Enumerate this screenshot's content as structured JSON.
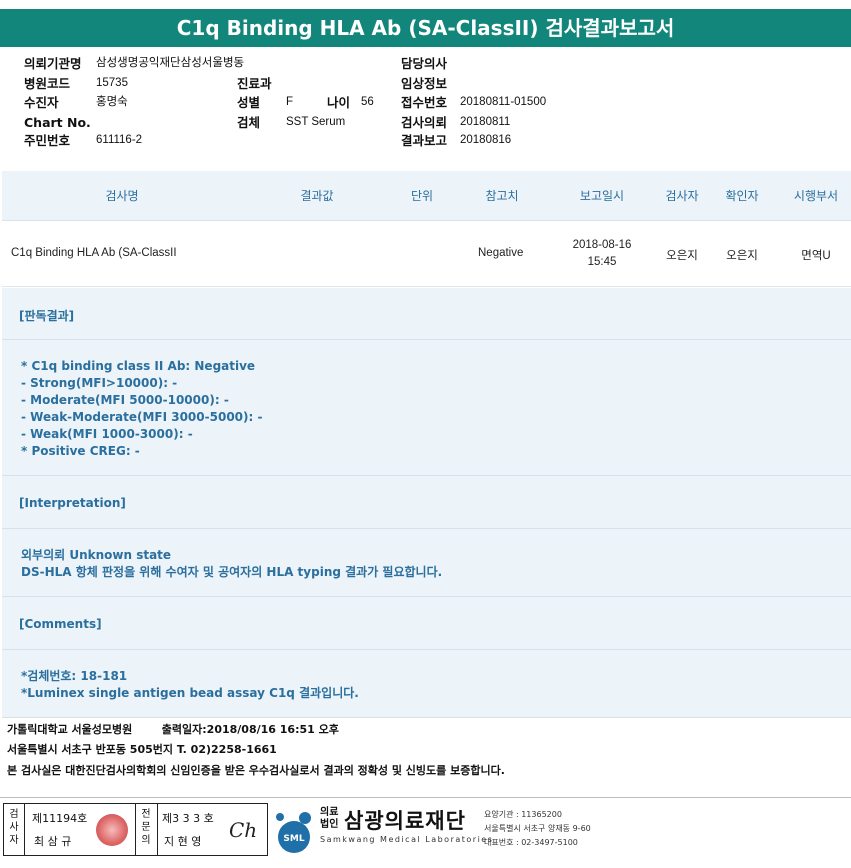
{
  "title": "C1q Binding HLA Ab (SA-ClassII) 검사결과보고서",
  "info": {
    "requester_label": "의뢰기관명",
    "requester_value": "삼성생명공익재단삼성서울병동",
    "hospital_code_label": "병원코드",
    "hospital_code_value": "15735",
    "patient_label": "수진자",
    "patient_value": "홍명숙",
    "chart_label": "Chart No.",
    "chart_value": "",
    "resident_label": "주민번호",
    "resident_value": "611116-2",
    "dept_label": "진료과",
    "dept_value": "",
    "sex_label": "성별",
    "sex_value": "F",
    "age_label": "나이",
    "age_value": "56",
    "specimen_label": "검체",
    "specimen_value": "SST Serum",
    "doctor_label": "담당의사",
    "doctor_value": "",
    "clinical_label": "임상정보",
    "clinical_value": "",
    "receipt_label": "접수번호",
    "receipt_value": "20180811-01500",
    "request_label": "검사의뢰",
    "request_value": "20180811",
    "report_label": "결과보고",
    "report_value": "20180816"
  },
  "table": {
    "headers": [
      "검사명",
      "결과값",
      "단위",
      "참고치",
      "보고일시",
      "검사자",
      "확인자",
      "시행부서"
    ],
    "row": {
      "test_name": "C1q Binding HLA Ab (SA-ClassII",
      "result": "",
      "unit": "",
      "reference": "Negative",
      "report_date": "2018-08-16",
      "report_time": "15:45",
      "tester": "오은지",
      "confirmer": "오은지",
      "department": "면역U"
    }
  },
  "judgement": {
    "heading": "[판독결과]",
    "lines": [
      "* C1q binding class II Ab: Negative",
      "- Strong(MFI>10000): -",
      "- Moderate(MFI 5000-10000): -",
      "- Weak-Moderate(MFI 3000-5000): -",
      "- Weak(MFI 1000-3000): -",
      "* Positive CREG: -"
    ]
  },
  "interpretation": {
    "heading": "[Interpretation]",
    "lines": [
      "외부의뢰 Unknown state",
      "DS-HLA 항체 판정을 위해 수여자 및 공여자의 HLA typing 결과가 필요합니다."
    ]
  },
  "comments": {
    "heading": "[Comments]",
    "lines": [
      "*검체번호: 18-181",
      "*Luminex single antigen bead assay C1q 결과입니다."
    ]
  },
  "footer": {
    "line1_org": "가톨릭대학교 서울성모병원",
    "line1_print": "출력일자:2018/08/16 16:51 오후",
    "line2": "서울특별시 서초구 반포동 505번지 T. 02)2258-1661",
    "line3": "본 검사실은 대한진단검사의학회의 신임인증을 받은 우수검사실로서 결과의 정확성 및 신빙도를 보증합니다."
  },
  "signatures": {
    "tester_label": "검사자",
    "tester_license": "제11194호",
    "tester_name": "최 삼 규",
    "specialist_label": "전문의",
    "specialist_license": "제3 3 3 호",
    "specialist_name": "지 현 영",
    "signature_mark": "Ch"
  },
  "logo": {
    "corp_line1": "의료",
    "corp_line2": "법인",
    "name": "삼광의료재단",
    "mark_text": "SML",
    "english": "Samkwang Medical Laboratories",
    "code": "요양기관 : 11365200",
    "address": "서울특별시 서초구 양재동 9-60",
    "phone": "대표번호 : 02-3497-5100"
  },
  "colors": {
    "accent": "#12867a",
    "section_bg": "#ecf3f9",
    "section_text": "#2a6f9e"
  }
}
